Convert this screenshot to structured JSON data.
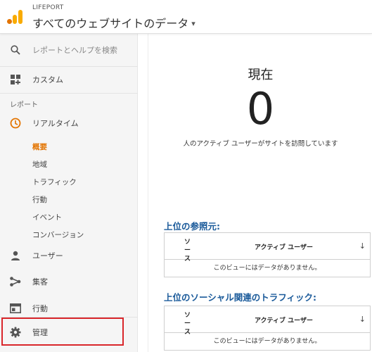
{
  "header": {
    "brand": "LIFEPORT",
    "property": "すべてのウェブサイトのデータ",
    "caret": "▾"
  },
  "sidebar": {
    "search_placeholder": "レポートとヘルプを検索",
    "custom": "カスタム",
    "reports_label": "レポート",
    "realtime": "リアルタイム",
    "realtime_items": [
      "概要",
      "地域",
      "トラフィック",
      "行動",
      "イベント",
      "コンバージョン"
    ],
    "users": "ユーザー",
    "acquisition": "集客",
    "behavior": "行動",
    "admin": "管理"
  },
  "main": {
    "now_label": "現在",
    "now_count": "0",
    "now_desc": "人のアクティブ ユーザーがサイトを訪問しています",
    "tables": [
      {
        "title": "上位の参照元:",
        "col_source": "ソース",
        "col_active": "アクティブ ユーザー",
        "sort_icon": "↓",
        "empty": "このビューにはデータがありません。"
      },
      {
        "title": "上位のソーシャル関連のトラフィック:",
        "col_source": "ソース",
        "col_active": "アクティブ ユーザー",
        "sort_icon": "↓",
        "empty": "このビューにはデータがありません。"
      }
    ]
  },
  "colors": {
    "accent": "#e37400",
    "title_blue": "#1a5a9a",
    "highlight_red": "#d9262b"
  }
}
